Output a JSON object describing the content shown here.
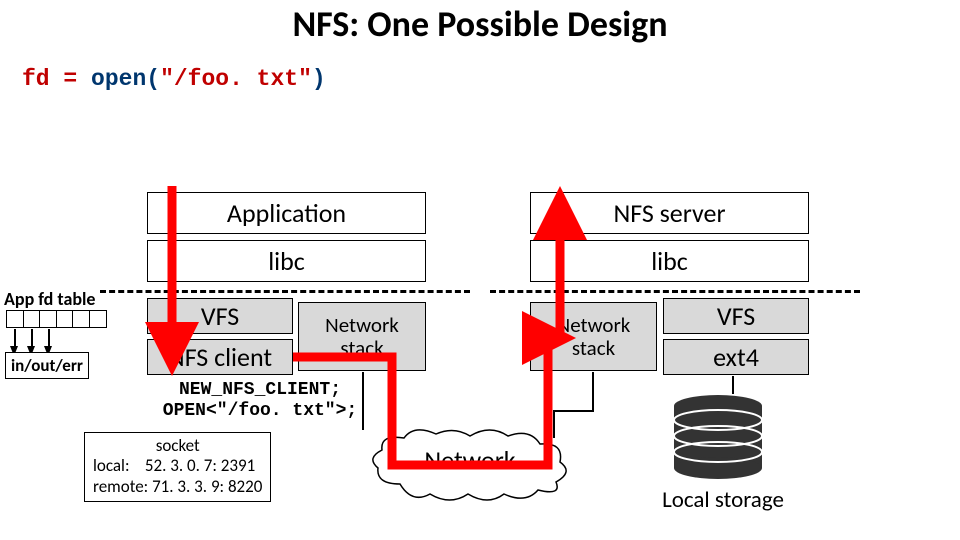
{
  "title": "NFS: One Possible Design",
  "code": {
    "lhs": "fd",
    "eq": " = ",
    "fn": "open",
    "paren_open": "(",
    "arg": "\"/foo. txt\"",
    "paren_close": ")"
  },
  "left": {
    "app": "Application",
    "libc": "libc",
    "vfs": "VFS",
    "nfs_client": "NFS client",
    "netstack": "Network\nstack"
  },
  "right": {
    "server": "NFS server",
    "libc": "libc",
    "netstack": "Network\nstack",
    "vfs": "VFS",
    "ext4": "ext4"
  },
  "fd_table_label": "App fd table",
  "in_out_err": "in/out/err",
  "protocol": {
    "line1": "NEW_NFS_CLIENT;",
    "line2": "OPEN<\"/foo. txt\">;"
  },
  "socket": {
    "header": "socket",
    "local": "local:    52. 3. 0. 7: 2391",
    "remote": "remote: 71. 3. 3. 9: 8220"
  },
  "network_label": "Network",
  "storage_label": "Local storage"
}
